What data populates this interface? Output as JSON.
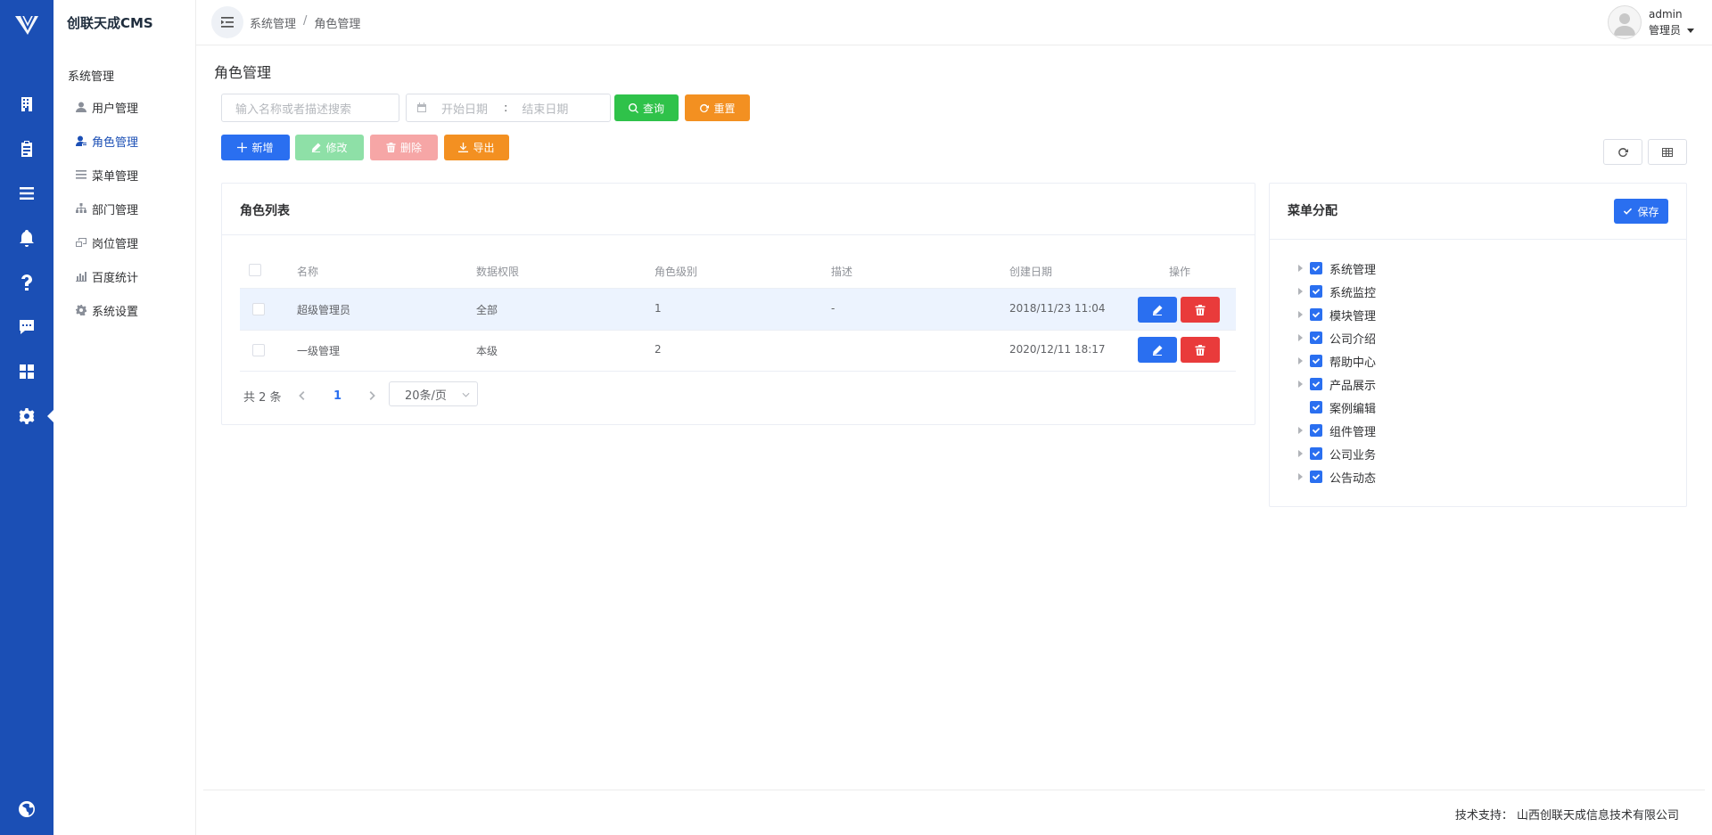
{
  "app": {
    "title": "创联天成CMS"
  },
  "rail": {
    "items": [
      "building",
      "clipboard",
      "list",
      "bell",
      "help",
      "chat",
      "apps",
      "settings",
      "globe"
    ],
    "active": "settings"
  },
  "submenu": {
    "heading": "系统管理",
    "items": [
      {
        "label": "用户管理",
        "icon": "user-icon"
      },
      {
        "label": "角色管理",
        "icon": "role-icon"
      },
      {
        "label": "菜单管理",
        "icon": "menu-icon"
      },
      {
        "label": "部门管理",
        "icon": "org-icon"
      },
      {
        "label": "岗位管理",
        "icon": "post-icon"
      },
      {
        "label": "百度统计",
        "icon": "chart-icon"
      },
      {
        "label": "系统设置",
        "icon": "gear-icon"
      }
    ],
    "active": "角色管理"
  },
  "header": {
    "breadcrumb": [
      "系统管理",
      "角色管理"
    ],
    "breadcrumb_sep": "/",
    "user": {
      "name": "admin",
      "role": "管理员"
    }
  },
  "page": {
    "title": "角色管理"
  },
  "search": {
    "keyword_placeholder": "输入名称或者描述搜索",
    "start_placeholder": "开始日期",
    "range_sep": ":",
    "end_placeholder": "结束日期",
    "query_label": "查询",
    "reset_label": "重置"
  },
  "toolbar": {
    "add": "新增",
    "edit": "修改",
    "delete": "删除",
    "export": "导出"
  },
  "role_list": {
    "title": "角色列表",
    "columns": [
      "名称",
      "数据权限",
      "角色级别",
      "描述",
      "创建日期",
      "操作"
    ],
    "rows": [
      {
        "name": "超级管理员",
        "scope": "全部",
        "level": "1",
        "desc": "-",
        "created": "2018/11/23 11:04",
        "highlighted": true
      },
      {
        "name": "一级管理",
        "scope": "本级",
        "level": "2",
        "desc": "",
        "created": "2020/12/11 18:17",
        "highlighted": false
      }
    ]
  },
  "pagination": {
    "total": "共 2 条",
    "current": "1",
    "page_size": "20条/页"
  },
  "menu_assign": {
    "title": "菜单分配",
    "save_label": "保存",
    "items": [
      {
        "label": "系统管理",
        "expandable": true,
        "checked": true
      },
      {
        "label": "系统监控",
        "expandable": true,
        "checked": true
      },
      {
        "label": "模块管理",
        "expandable": true,
        "checked": true
      },
      {
        "label": "公司介绍",
        "expandable": true,
        "checked": true
      },
      {
        "label": "帮助中心",
        "expandable": true,
        "checked": true
      },
      {
        "label": "产品展示",
        "expandable": true,
        "checked": true
      },
      {
        "label": "案例编辑",
        "expandable": false,
        "checked": true
      },
      {
        "label": "组件管理",
        "expandable": true,
        "checked": true
      },
      {
        "label": "公司业务",
        "expandable": true,
        "checked": true
      },
      {
        "label": "公告动态",
        "expandable": true,
        "checked": true
      }
    ]
  },
  "footer": {
    "label": "技术支持：",
    "company": "山西创联天成信息技术有限公司"
  },
  "colors": {
    "brand": "#1b4fb5",
    "primary": "#2a6ff0",
    "success": "#2fc24a",
    "warning": "#f39021",
    "danger": "#e93b3b",
    "row_highlight": "#ecf3fe"
  }
}
